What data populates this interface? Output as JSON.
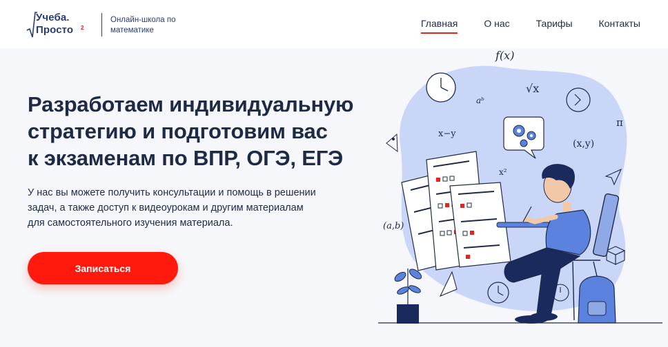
{
  "header": {
    "logo_line1": "Учеба.",
    "logo_line2": "Просто",
    "logo_sup": "2",
    "logo_subtitle": "Онлайн-школа по математике"
  },
  "nav": {
    "items": [
      "Главная",
      "О нас",
      "Тарифы",
      "Контакты"
    ],
    "active_index": 0
  },
  "hero": {
    "title_lines": [
      "Разработаем индивидуальную",
      "стратегию и подготовим вас",
      "к экзаменам по ВПР, ОГЭ, ЕГЭ"
    ],
    "description_lines": [
      "У нас вы можете получить консультации и помощь в решении",
      "задач, а также доступ к видеоурокам и другим материалам",
      "для самостоятельного изучения материала."
    ],
    "cta_label": "Записаться"
  },
  "illustration": {
    "doodles": [
      "f(x)",
      "√x",
      "aᵇ",
      "x−y",
      "x²",
      "(x,y)",
      "π",
      "(a,b)"
    ]
  },
  "colors": {
    "accent": "#ff1a0d",
    "text": "#1f2a44",
    "blob": "#c9d6f7",
    "shirt": "#5b82de",
    "pants": "#1b2a5c"
  }
}
